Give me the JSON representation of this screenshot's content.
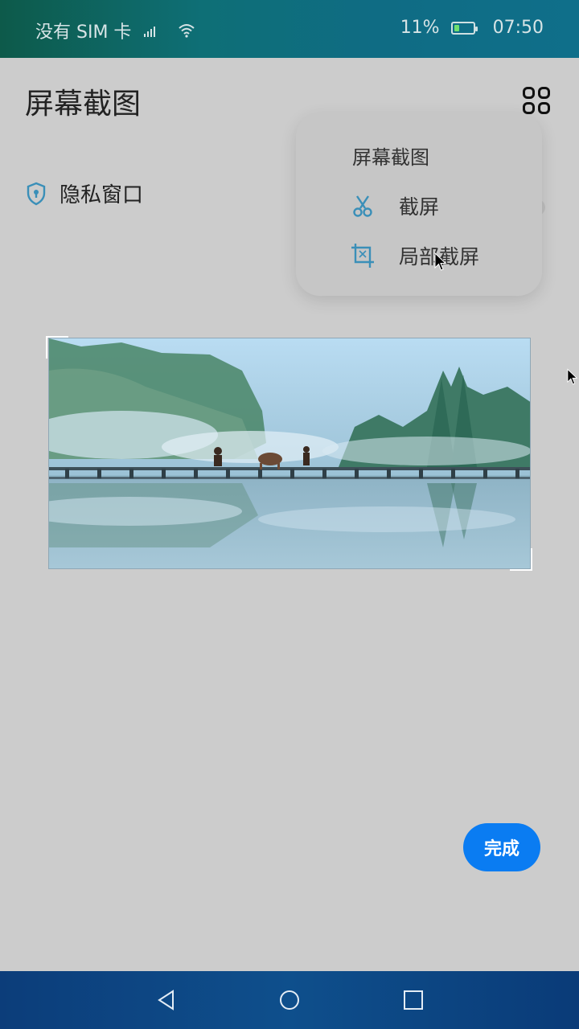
{
  "status_bar": {
    "carrier": "没有 SIM 卡",
    "battery_percent": "11%",
    "time": "07:50",
    "battery_level_fraction": 0.11
  },
  "header": {
    "title": "屏幕截图",
    "menu_icon": "grid-icon"
  },
  "privacy": {
    "label": "隐私窗口",
    "icon": "shield-icon"
  },
  "popup_menu": {
    "title": "屏幕截图",
    "items": [
      {
        "label": "截屏",
        "icon": "scissors-icon"
      },
      {
        "label": "局部截屏",
        "icon": "crop-icon"
      }
    ]
  },
  "screenshot_image": {
    "description_icon": "landscape-image"
  },
  "actions": {
    "done_label": "完成"
  },
  "nav_bar": {
    "icons": [
      "back-icon",
      "home-icon",
      "recent-apps-icon"
    ]
  },
  "colors": {
    "accent": "#0a7cf2",
    "icon_blue": "#3a8fb8",
    "background": "#cccccc"
  }
}
